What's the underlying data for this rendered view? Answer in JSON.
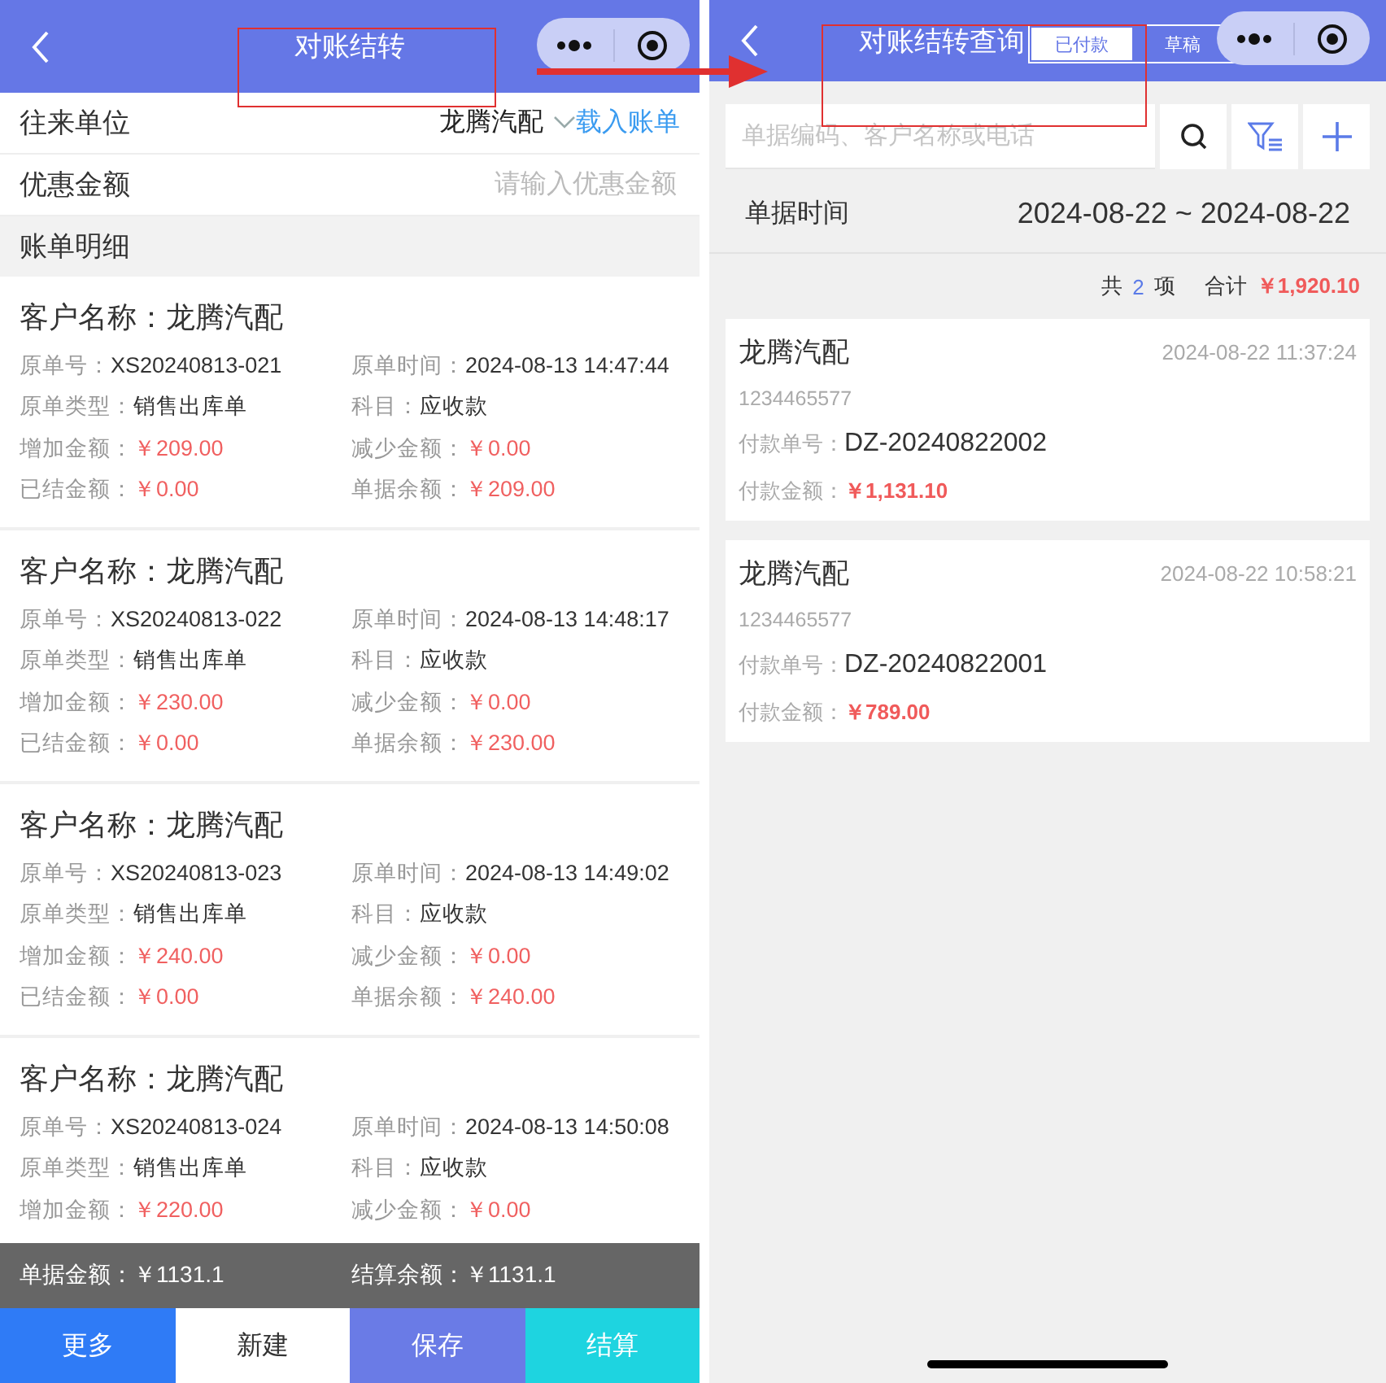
{
  "left_screen": {
    "header": {
      "title": "对账结转"
    },
    "partner_row": {
      "label": "往来单位",
      "value": "龙腾汽配",
      "action": "载入账单"
    },
    "discount_row": {
      "label": "优惠金额",
      "placeholder": "请输入优惠金额"
    },
    "section_title": "账单明细",
    "bills": [
      {
        "title": "客户名称：龙腾汽配",
        "fields": [
          {
            "label": "原单号：",
            "value": "XS20240813-021",
            "kind": "text"
          },
          {
            "label": "原单时间：",
            "value": "2024-08-13 14:47:44",
            "kind": "text"
          },
          {
            "label": "原单类型：",
            "value": "销售出库单",
            "kind": "text"
          },
          {
            "label": "科目：",
            "value": "应收款",
            "kind": "text"
          },
          {
            "label": "增加金额：",
            "value": "￥209.00",
            "kind": "money"
          },
          {
            "label": "减少金额：",
            "value": "￥0.00",
            "kind": "money"
          },
          {
            "label": "已结金额：",
            "value": "￥0.00",
            "kind": "money"
          },
          {
            "label": "单据余额：",
            "value": "￥209.00",
            "kind": "money"
          }
        ]
      },
      {
        "title": "客户名称：龙腾汽配",
        "fields": [
          {
            "label": "原单号：",
            "value": "XS20240813-022",
            "kind": "text"
          },
          {
            "label": "原单时间：",
            "value": "2024-08-13 14:48:17",
            "kind": "text"
          },
          {
            "label": "原单类型：",
            "value": "销售出库单",
            "kind": "text"
          },
          {
            "label": "科目：",
            "value": "应收款",
            "kind": "text"
          },
          {
            "label": "增加金额：",
            "value": "￥230.00",
            "kind": "money"
          },
          {
            "label": "减少金额：",
            "value": "￥0.00",
            "kind": "money"
          },
          {
            "label": "已结金额：",
            "value": "￥0.00",
            "kind": "money"
          },
          {
            "label": "单据余额：",
            "value": "￥230.00",
            "kind": "money"
          }
        ]
      },
      {
        "title": "客户名称：龙腾汽配",
        "fields": [
          {
            "label": "原单号：",
            "value": "XS20240813-023",
            "kind": "text"
          },
          {
            "label": "原单时间：",
            "value": "2024-08-13 14:49:02",
            "kind": "text"
          },
          {
            "label": "原单类型：",
            "value": "销售出库单",
            "kind": "text"
          },
          {
            "label": "科目：",
            "value": "应收款",
            "kind": "text"
          },
          {
            "label": "增加金额：",
            "value": "￥240.00",
            "kind": "money"
          },
          {
            "label": "减少金额：",
            "value": "￥0.00",
            "kind": "money"
          },
          {
            "label": "已结金额：",
            "value": "￥0.00",
            "kind": "money"
          },
          {
            "label": "单据余额：",
            "value": "￥240.00",
            "kind": "money"
          }
        ]
      },
      {
        "title": "客户名称：龙腾汽配",
        "fields": [
          {
            "label": "原单号：",
            "value": "XS20240813-024",
            "kind": "text"
          },
          {
            "label": "原单时间：",
            "value": "2024-08-13 14:50:08",
            "kind": "text"
          },
          {
            "label": "原单类型：",
            "value": "销售出库单",
            "kind": "text"
          },
          {
            "label": "科目：",
            "value": "应收款",
            "kind": "text"
          },
          {
            "label": "增加金额：",
            "value": "￥220.00",
            "kind": "money"
          },
          {
            "label": "减少金额：",
            "value": "￥0.00",
            "kind": "money"
          }
        ]
      }
    ],
    "totals": [
      "单据金额：￥1131.1",
      "结算余额：￥1131.1"
    ],
    "actions": [
      {
        "label": "更多",
        "kind": "more"
      },
      {
        "label": "新建",
        "kind": "new"
      },
      {
        "label": "保存",
        "kind": "save"
      },
      {
        "label": "结算",
        "kind": "settle"
      }
    ]
  },
  "right_screen": {
    "header": {
      "title": "对账结转查询",
      "tabs": [
        {
          "label": "已付款",
          "selected": true
        },
        {
          "label": "草稿",
          "selected": false
        }
      ]
    },
    "search": {
      "placeholder": "单据编码、客户名称或电话"
    },
    "date_row": {
      "label": "单据时间",
      "value": "2024-08-22 ~ 2024-08-22"
    },
    "summary": {
      "count_prefix": "共",
      "count": "2",
      "count_suffix": "项",
      "total_label": "合计",
      "total": "￥1,920.10"
    },
    "payments": [
      {
        "name": "龙腾汽配",
        "time": "2024-08-22 11:37:24",
        "phone": "1234465577",
        "number_label": "付款单号：",
        "number": "DZ-20240822002",
        "amount_label": "付款金额：",
        "amount": "￥1,131.10"
      },
      {
        "name": "龙腾汽配",
        "time": "2024-08-22 10:58:21",
        "phone": "1234465577",
        "number_label": "付款单号：",
        "number": "DZ-20240822001",
        "amount_label": "付款金额：",
        "amount": "￥789.00"
      }
    ]
  },
  "annotations": [
    {
      "kind": "frame"
    },
    {
      "kind": "frame"
    },
    {
      "kind": "arrow"
    }
  ]
}
